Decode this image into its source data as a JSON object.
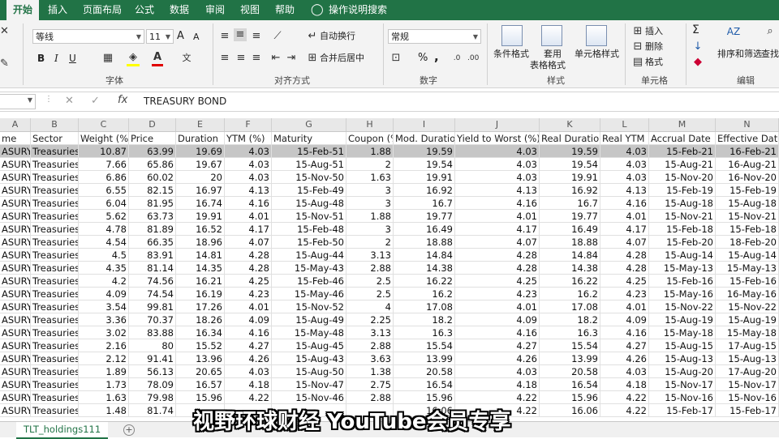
{
  "ribbon_tabs": [
    "开始",
    "插入",
    "页面布局",
    "公式",
    "数据",
    "审阅",
    "视图",
    "帮助"
  ],
  "tell_me": "操作说明搜索",
  "font": {
    "name": "等线",
    "size": "11",
    "grow": "A",
    "shrink": "A",
    "bold": "B",
    "italic": "I",
    "underline": "U"
  },
  "alignment": {
    "wrap_text": "自动换行",
    "merge_center": "合并后居中"
  },
  "number": {
    "format": "常规",
    "percent": "%",
    "comma": ","
  },
  "styles": {
    "conditional": "条件格式",
    "table_line1": "套用",
    "table_line2": "表格格式",
    "cell_styles": "单元格样式"
  },
  "cells": {
    "insert": "插入",
    "delete": "删除",
    "format": "格式"
  },
  "editing": {
    "sum": "Σ",
    "sort_filter": "排序和筛选",
    "find": "查找"
  },
  "group_labels": {
    "font": "字体",
    "alignment": "对齐方式",
    "number": "数字",
    "styles": "样式",
    "cells": "单元格",
    "editing": "编辑"
  },
  "formula_bar": {
    "fx": "fx",
    "value": "TREASURY BOND"
  },
  "columns": [
    "A",
    "B",
    "C",
    "D",
    "E",
    "F",
    "G",
    "H",
    "I",
    "J",
    "K",
    "L",
    "M",
    "N"
  ],
  "header_row": [
    "me",
    "Sector",
    "Weight (%)",
    "Price",
    "Duration",
    "YTM (%)",
    "Maturity",
    "Coupon (%)",
    "Mod. Duratio",
    "Yield to Worst (%)",
    "Real Duration",
    "Real YTM (%)",
    "Accrual Date",
    "Effective Date"
  ],
  "rows": [
    [
      "ASURY",
      "Treasuries",
      "10.87",
      "63.99",
      "19.69",
      "4.03",
      "15-Feb-51",
      "1.88",
      "19.59",
      "4.03",
      "19.59",
      "4.03",
      "15-Feb-21",
      "16-Feb-21"
    ],
    [
      "ASURY",
      "Treasuries",
      "7.66",
      "65.86",
      "19.67",
      "4.03",
      "15-Aug-51",
      "2",
      "19.54",
      "4.03",
      "19.54",
      "4.03",
      "15-Aug-21",
      "16-Aug-21"
    ],
    [
      "ASURY",
      "Treasuries",
      "6.86",
      "60.02",
      "20",
      "4.03",
      "15-Nov-50",
      "1.63",
      "19.91",
      "4.03",
      "19.91",
      "4.03",
      "15-Nov-20",
      "16-Nov-20"
    ],
    [
      "ASURY",
      "Treasuries",
      "6.55",
      "82.15",
      "16.97",
      "4.13",
      "15-Feb-49",
      "3",
      "16.92",
      "4.13",
      "16.92",
      "4.13",
      "15-Feb-19",
      "15-Feb-19"
    ],
    [
      "ASURY",
      "Treasuries",
      "6.04",
      "81.95",
      "16.74",
      "4.16",
      "15-Aug-48",
      "3",
      "16.7",
      "4.16",
      "16.7",
      "4.16",
      "15-Aug-18",
      "15-Aug-18"
    ],
    [
      "ASURY",
      "Treasuries",
      "5.62",
      "63.73",
      "19.91",
      "4.01",
      "15-Nov-51",
      "1.88",
      "19.77",
      "4.01",
      "19.77",
      "4.01",
      "15-Nov-21",
      "15-Nov-21"
    ],
    [
      "ASURY",
      "Treasuries",
      "4.78",
      "81.89",
      "16.52",
      "4.17",
      "15-Feb-48",
      "3",
      "16.49",
      "4.17",
      "16.49",
      "4.17",
      "15-Feb-18",
      "15-Feb-18"
    ],
    [
      "ASURY",
      "Treasuries",
      "4.54",
      "66.35",
      "18.96",
      "4.07",
      "15-Feb-50",
      "2",
      "18.88",
      "4.07",
      "18.88",
      "4.07",
      "15-Feb-20",
      "18-Feb-20"
    ],
    [
      "ASURY",
      "Treasuries",
      "4.5",
      "83.91",
      "14.81",
      "4.28",
      "15-Aug-44",
      "3.13",
      "14.84",
      "4.28",
      "14.84",
      "4.28",
      "15-Aug-14",
      "15-Aug-14"
    ],
    [
      "ASURY",
      "Treasuries",
      "4.35",
      "81.14",
      "14.35",
      "4.28",
      "15-May-43",
      "2.88",
      "14.38",
      "4.28",
      "14.38",
      "4.28",
      "15-May-13",
      "15-May-13"
    ],
    [
      "ASURY",
      "Treasuries",
      "4.2",
      "74.56",
      "16.21",
      "4.25",
      "15-Feb-46",
      "2.5",
      "16.22",
      "4.25",
      "16.22",
      "4.25",
      "15-Feb-16",
      "15-Feb-16"
    ],
    [
      "ASURY",
      "Treasuries",
      "4.09",
      "74.54",
      "16.19",
      "4.23",
      "15-May-46",
      "2.5",
      "16.2",
      "4.23",
      "16.2",
      "4.23",
      "15-May-16",
      "16-May-16"
    ],
    [
      "ASURY",
      "Treasuries",
      "3.54",
      "99.81",
      "17.26",
      "4.01",
      "15-Nov-52",
      "4",
      "17.08",
      "4.01",
      "17.08",
      "4.01",
      "15-Nov-22",
      "15-Nov-22"
    ],
    [
      "ASURY",
      "Treasuries",
      "3.36",
      "70.37",
      "18.26",
      "4.09",
      "15-Aug-49",
      "2.25",
      "18.2",
      "4.09",
      "18.2",
      "4.09",
      "15-Aug-19",
      "15-Aug-19"
    ],
    [
      "ASURY",
      "Treasuries",
      "3.02",
      "83.88",
      "16.34",
      "4.16",
      "15-May-48",
      "3.13",
      "16.3",
      "4.16",
      "16.3",
      "4.16",
      "15-May-18",
      "15-May-18"
    ],
    [
      "ASURY",
      "Treasuries",
      "2.16",
      "80",
      "15.52",
      "4.27",
      "15-Aug-45",
      "2.88",
      "15.54",
      "4.27",
      "15.54",
      "4.27",
      "15-Aug-15",
      "17-Aug-15"
    ],
    [
      "ASURY",
      "Treasuries",
      "2.12",
      "91.41",
      "13.96",
      "4.26",
      "15-Aug-43",
      "3.63",
      "13.99",
      "4.26",
      "13.99",
      "4.26",
      "15-Aug-13",
      "15-Aug-13"
    ],
    [
      "ASURY",
      "Treasuries",
      "1.89",
      "56.13",
      "20.65",
      "4.03",
      "15-Aug-50",
      "1.38",
      "20.58",
      "4.03",
      "20.58",
      "4.03",
      "15-Aug-20",
      "17-Aug-20"
    ],
    [
      "ASURY",
      "Treasuries",
      "1.73",
      "78.09",
      "16.57",
      "4.18",
      "15-Nov-47",
      "2.75",
      "16.54",
      "4.18",
      "16.54",
      "4.18",
      "15-Nov-17",
      "15-Nov-17"
    ],
    [
      "ASURY",
      "Treasuries",
      "1.63",
      "79.98",
      "15.96",
      "4.22",
      "15-Nov-46",
      "2.88",
      "15.96",
      "4.22",
      "15.96",
      "4.22",
      "15-Nov-16",
      "15-Nov-16"
    ],
    [
      "ASURY",
      "Treasuries",
      "1.48",
      "81.74",
      "",
      "",
      "",
      "",
      "16.06",
      "4.22",
      "16.06",
      "4.22",
      "15-Feb-17",
      "15-Feb-17"
    ]
  ],
  "sheet_tab": "TLT_holdings111",
  "caption": "视野环球财经 YouTube会员专享",
  "colors": {
    "ribbon_green": "#217346",
    "selected_row": "#c6c6c6"
  }
}
